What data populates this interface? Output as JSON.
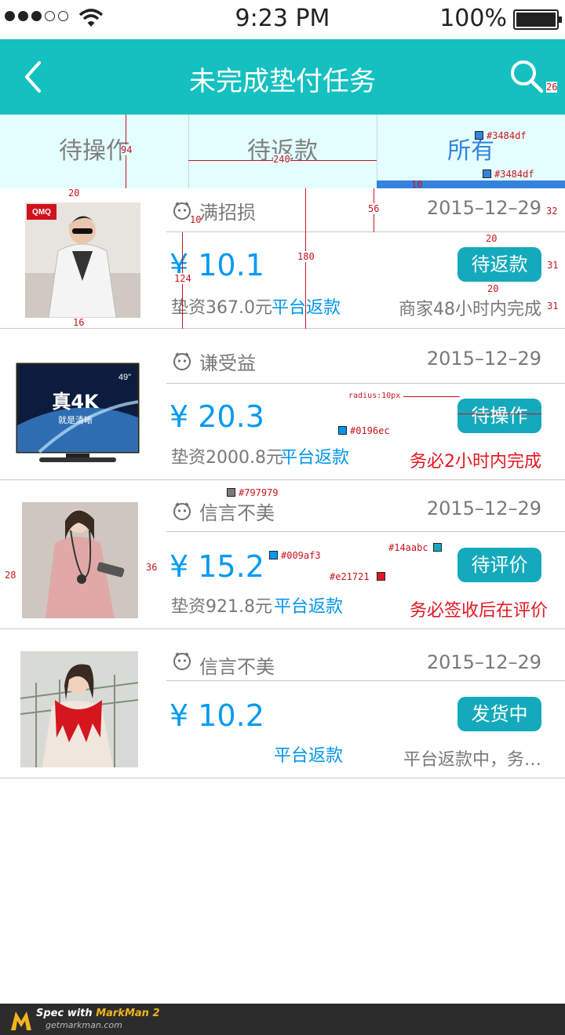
{
  "status": {
    "time": "9:23 PM",
    "battery": "100%"
  },
  "nav": {
    "title": "未完成垫付任务"
  },
  "tabs": [
    "待操作",
    "待返款",
    "所有"
  ],
  "colors": {
    "nav": "#14c1c0",
    "tab_active": "#3484df",
    "tab_bg": "#e4fefe",
    "price": "#009af3",
    "link": "#0196ec",
    "meta": "#797979",
    "button": "#14aabc",
    "warning": "#e21721"
  },
  "orders": [
    {
      "shop": "满招损",
      "date": "2015–12–29",
      "price": "¥ 10.1",
      "advance": "垫资367.0元",
      "refund": "平台返款",
      "button": "待返款",
      "note": "商家48小时内完成",
      "thumb_icon": "jacket-photo"
    },
    {
      "shop": "谦受益",
      "date": "2015–12–29",
      "price": "¥ 20.3",
      "advance": "垫资2000.8元",
      "refund": "平台返款",
      "button": "待操作",
      "note": "务必2小时内完成",
      "thumb_icon": "tv-photo",
      "thumb_text": {
        "size": "49\"",
        "big": "真4K",
        "small": "就是清晰"
      }
    },
    {
      "shop": "信言不美",
      "date": "2015–12–29",
      "price": "¥ 15.2",
      "advance": "垫资921.8元",
      "refund": "平台返款",
      "button": "待评价",
      "note": "务必签收后在评价",
      "thumb_icon": "pink-dress-photo"
    },
    {
      "shop": "信言不美",
      "date": "2015–12–29",
      "price": "¥ 10.2",
      "advance": "",
      "refund": "平台返款",
      "button": "发货中",
      "note": "平台返款中，务…",
      "thumb_icon": "red-scarf-photo"
    }
  ],
  "annotations": {
    "tab_height": "94",
    "tab_width": "240",
    "underline_h": "10",
    "color_tab": "#3484df",
    "color_underline": "#3484df",
    "nav_right": "26",
    "thumb_top": "20",
    "icon_size": "10",
    "subhead_h": "56",
    "row_h": "180",
    "price_h": "124",
    "thumb_bottom": "16",
    "date_right": "32",
    "btn_gap_top": "20",
    "btn_gap_bottom": "20",
    "btn_right": "31",
    "note_right": "31",
    "radius": "radius:10px",
    "btn_w": "107",
    "link_color": "#0196ec",
    "meta_color": "#797979",
    "price_color": "#009af3",
    "btn_color": "#14aabc",
    "warn_color": "#e21721",
    "thumb_left": "28",
    "thumb_gap": "36"
  },
  "footer": {
    "line1a": "Spec with ",
    "line1b": "MarkMan 2",
    "line2": "getmarkman.com"
  }
}
